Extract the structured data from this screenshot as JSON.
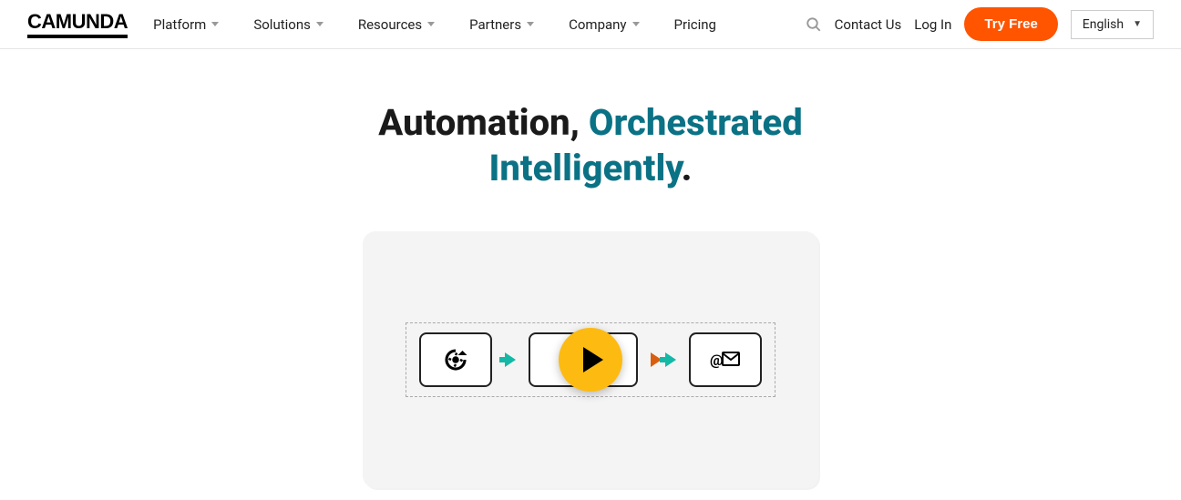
{
  "brand": "CAMUNDA",
  "nav": {
    "items": [
      {
        "label": "Platform",
        "dropdown": true
      },
      {
        "label": "Solutions",
        "dropdown": true
      },
      {
        "label": "Resources",
        "dropdown": true
      },
      {
        "label": "Partners",
        "dropdown": true
      },
      {
        "label": "Company",
        "dropdown": true
      },
      {
        "label": "Pricing",
        "dropdown": false
      }
    ]
  },
  "actions": {
    "contact": "Contact Us",
    "login": "Log In",
    "cta": "Try Free"
  },
  "language": {
    "selected": "English"
  },
  "hero": {
    "line1_plain": "Automation, ",
    "line1_accent": "Orchestrated",
    "line2_accent": "Intelligently",
    "period": "."
  },
  "video": {
    "icons": [
      "cycle-gear-icon",
      "at-mail-icon"
    ]
  },
  "colors": {
    "accent_teal": "#0b7285",
    "cta_orange": "#ff5400",
    "play_yellow": "#fdbb11"
  }
}
